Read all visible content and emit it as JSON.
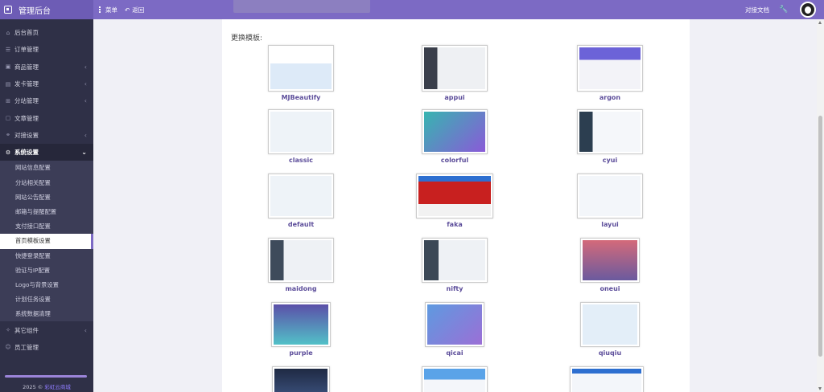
{
  "brand": {
    "title": "管理后台"
  },
  "topbar": {
    "menu_label": "菜单",
    "back_label": "返回",
    "docs_label": "对接文档"
  },
  "sidebar": {
    "items": [
      {
        "label": "后台首页",
        "icon": "home-icon"
      },
      {
        "label": "订单管理",
        "icon": "list-icon"
      },
      {
        "label": "商品管理",
        "icon": "box-icon"
      },
      {
        "label": "发卡管理",
        "icon": "card-icon"
      },
      {
        "label": "分站管理",
        "icon": "site-icon"
      },
      {
        "label": "文章管理",
        "icon": "doc-icon"
      },
      {
        "label": "对接设置",
        "icon": "link-icon"
      },
      {
        "label": "系统设置",
        "icon": "gear-icon"
      }
    ],
    "sub_items": [
      "网站信息配置",
      "分站相关配置",
      "网站公告配置",
      "邮箱与提醒配置",
      "支付接口配置",
      "首页模板设置",
      "快捷登录配置",
      "验证与IP配置",
      "Logo与背景设置",
      "计划任务设置",
      "系统数据清理"
    ],
    "bottom_items": [
      {
        "label": "其它组件",
        "icon": "puzzle-icon"
      },
      {
        "label": "员工管理",
        "icon": "user-icon"
      }
    ],
    "footer_prefix": "2025 ©",
    "footer_link": "彩虹云商城"
  },
  "content": {
    "section_title": "更换模板:",
    "templates": [
      "MJBeautify",
      "appui",
      "argon",
      "classic",
      "colorful",
      "cyui",
      "default",
      "faka",
      "layui",
      "maidong",
      "nifty",
      "oneui",
      "purple",
      "qicai",
      "qiuqiu"
    ]
  },
  "colors": {
    "accent": "#7c6ac4",
    "sidebar_bg": "#2f3047",
    "template_name": "#5c4d9a"
  }
}
